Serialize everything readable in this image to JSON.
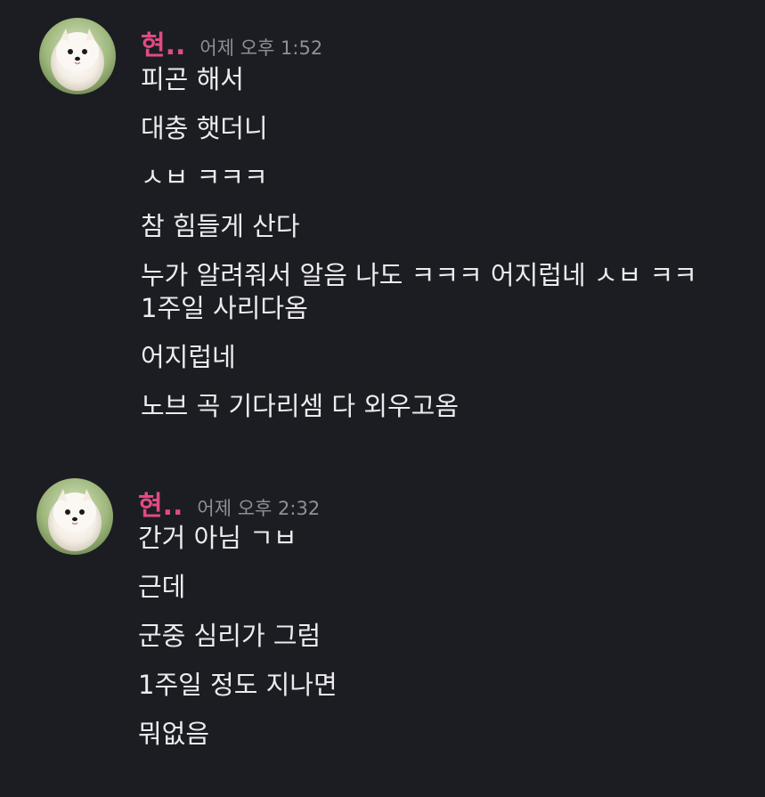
{
  "colors": {
    "background": "#1c1d22",
    "username": "#e24a86",
    "timestamp": "#8e9097",
    "message_text": "#ececef"
  },
  "messages": [
    {
      "avatar_icon": "pomeranian-avatar-icon",
      "username": "현..",
      "timestamp": "어제 오후 1:52",
      "lines": [
        "피곤 해서",
        "대충 햇더니",
        "ㅅㅂ ㅋㅋㅋ",
        "참 힘들게 산다",
        "누가 알려줘서 알음 나도 ㅋㅋㅋ 어지럽네 ㅅㅂ ㅋㅋ 1주일 사리다옴",
        "어지럽네",
        "노브 곡 기다리셈 다 외우고옴"
      ]
    },
    {
      "avatar_icon": "pomeranian-avatar-icon",
      "username": "현..",
      "timestamp": "어제 오후 2:32",
      "lines": [
        "간거 아님 ㄱㅂ",
        "근데",
        "군중 심리가 그럼",
        "1주일 정도 지나면",
        "뭐없음"
      ]
    }
  ]
}
